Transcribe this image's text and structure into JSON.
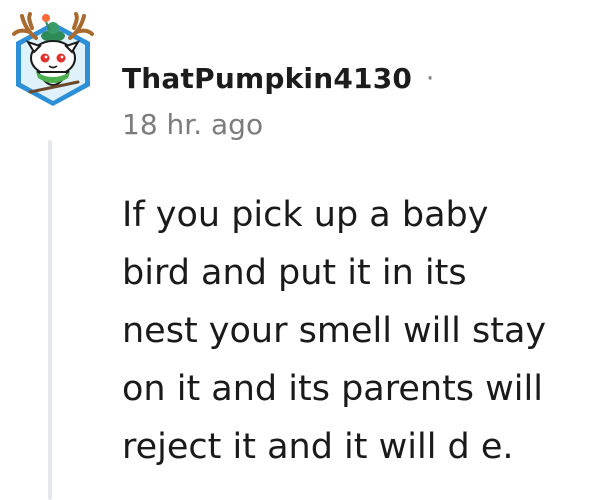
{
  "comment": {
    "author": "ThatPumpkin4130",
    "separator": "·",
    "time_ago": "18 hr. ago",
    "body_lines": [
      "If you pick up a baby",
      "bird and put it in its",
      "nest your smell will stay",
      "on it and its parents will",
      "reject it and it will d e."
    ]
  },
  "icons": {
    "avatar": "snoo-avatar-with-antlers-icon"
  },
  "colors": {
    "thread_line": "#e5e7eb",
    "meta_text": "#7c7c7c",
    "text": "#1a1a1b"
  }
}
